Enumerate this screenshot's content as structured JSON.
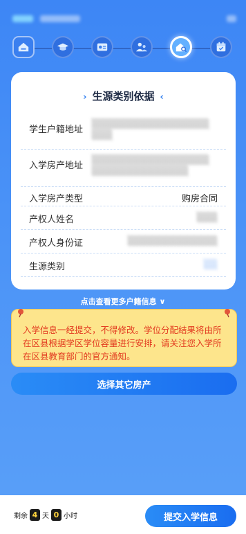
{
  "header": {
    "app_name": "",
    "subtitle": "",
    "right_text": ""
  },
  "steps": [
    {
      "icon": "house-icon",
      "state": "done"
    },
    {
      "icon": "graduation-cap-icon",
      "state": "done"
    },
    {
      "icon": "id-card-icon",
      "state": "done"
    },
    {
      "icon": "family-icon",
      "state": "done"
    },
    {
      "icon": "home-search-icon",
      "state": "active"
    },
    {
      "icon": "calendar-icon",
      "state": "todo"
    }
  ],
  "card": {
    "title": "生源类别依据",
    "rows": [
      {
        "label": "学生户籍地址",
        "value": ""
      },
      {
        "label": "入学房产地址",
        "value": ""
      },
      {
        "label": "入学房产类型",
        "value": "购房合同"
      },
      {
        "label": "产权人姓名",
        "value": ""
      },
      {
        "label": "产权人身份证",
        "value": ""
      },
      {
        "label": "生源类别",
        "value": ""
      }
    ]
  },
  "more_link": "点击查看更多户籍信息",
  "notice": "入学信息一经提交，不得修改。学位分配结果将由所在区县根据学区学位容量进行安排，请关注您入学所在区县教育部门的官方通知。",
  "buttons": {
    "other_house": "选择其它房产",
    "submit": "提交入学信息"
  },
  "countdown": {
    "prefix": "剩余",
    "days": "4",
    "days_unit": "天",
    "hours": "0",
    "hours_unit": "小时"
  },
  "colors": {
    "primary": "#2a8cf6",
    "background": "#4a92f7",
    "notice_bg": "#fde58c",
    "notice_text": "#e23a20"
  }
}
